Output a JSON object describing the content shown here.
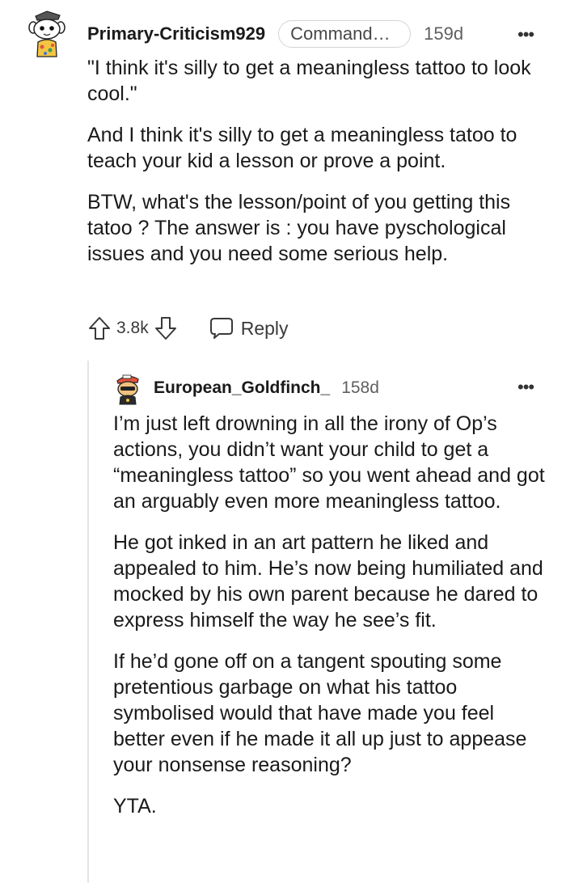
{
  "comment": {
    "username": "Primary-Criticism929",
    "flair": "Commander i...",
    "age": "159d",
    "more": "•••",
    "paragraphs": [
      "\"I think it's silly to get a meaningless tattoo to look cool.\"",
      "And I think it's silly to get a meaningless tatoo to teach your kid a lesson or prove a point.",
      "BTW, what's the lesson/point of you getting this tatoo ? The answer is : you have pyschological issues and you need some serious help."
    ],
    "votes": "3.8k",
    "reply_label": "Reply",
    "avatar_icon": "snoo-avatar-icon"
  },
  "reply": {
    "username": "European_Goldfinch_",
    "age": "158d",
    "more": "•••",
    "paragraphs": [
      "I’m just left drowning in all the irony of Op’s actions, you didn’t want your child to get a “meaningless tattoo” so you went ahead and got an arguably even more meaningless tattoo.",
      "He got inked in an art pattern he liked and appealed to him. He’s now being humiliated and mocked by his own parent because he dared to express himself the way he see’s fit.",
      "If he’d gone off on a tangent spouting some pretentious garbage on what his tattoo symbolised would that have made you feel better even if he made it all up just to appease your nonsense reasoning?",
      "YTA."
    ],
    "avatar_icon": "snoo-avatar-icon"
  },
  "icons": {
    "upvote": "arrow-up-icon",
    "downvote": "arrow-down-icon",
    "reply": "speech-bubble-icon",
    "more": "ellipsis-icon"
  },
  "colors": {
    "text": "#1a1a1b",
    "meta": "#5f5f5f",
    "thread_line": "#e4e4e4"
  }
}
